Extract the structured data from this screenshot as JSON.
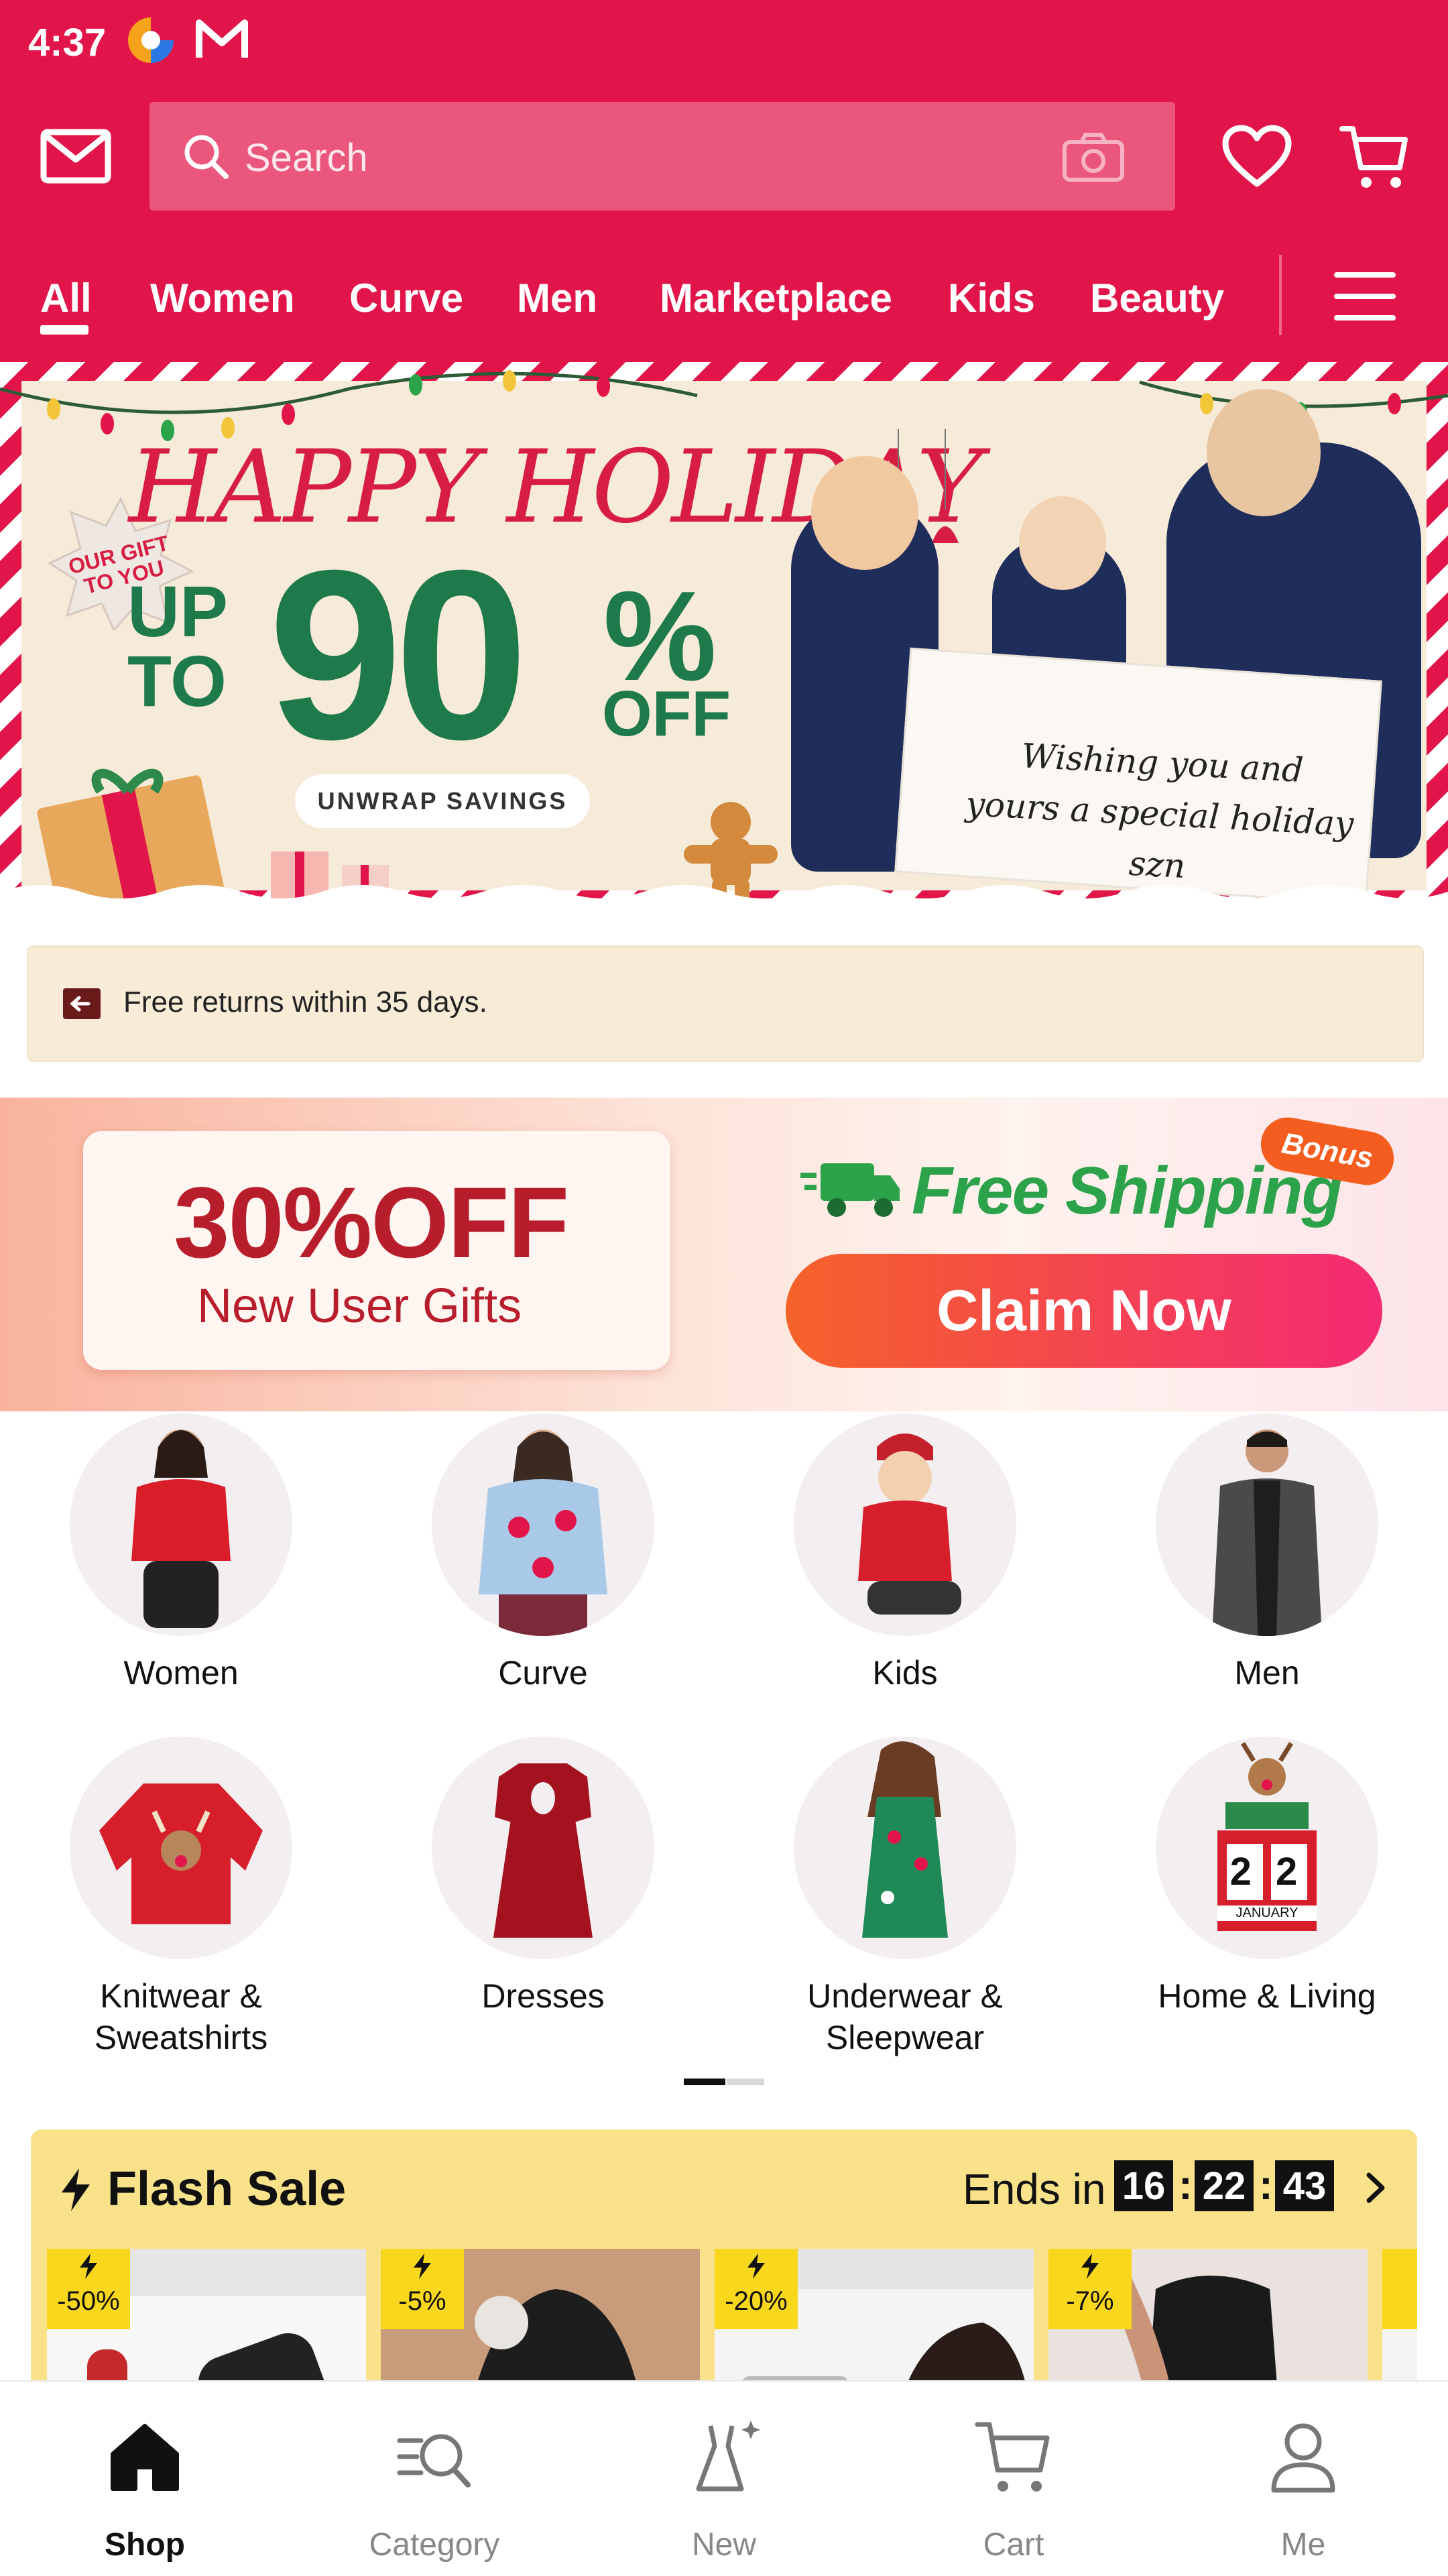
{
  "status_bar": {
    "time": "4:37"
  },
  "header": {
    "search_placeholder": "Search",
    "nav_tabs": [
      "All",
      "Women",
      "Curve",
      "Men",
      "Marketplace",
      "Kids",
      "Beauty"
    ],
    "active_tab": "All",
    "colors": {
      "brand": "#e2154a"
    }
  },
  "hero_banner": {
    "headline": "HAPPY HOLIDAY",
    "badge": "OUR GIFT TO YOU",
    "up_to_line1": "UP",
    "up_to_line2": "TO",
    "percent": "90",
    "percent_sign": "%",
    "off": "OFF",
    "cta": "UNWRAP SAVINGS",
    "card_text_line1": "Wishing you and",
    "card_text_line2": "yours a special holiday szn"
  },
  "info_bar": {
    "text": "Free returns within 35 days."
  },
  "promo": {
    "coupon_value": "30%OFF",
    "coupon_sub": "New User Gifts",
    "free_shipping": "Free Shipping",
    "bonus": "Bonus",
    "claim": "Claim Now"
  },
  "categories": [
    {
      "label": "Women",
      "icon": "woman-red-top-image"
    },
    {
      "label": "Curve",
      "icon": "curve-sweater-image"
    },
    {
      "label": "Kids",
      "icon": "kid-sweater-image"
    },
    {
      "label": "Men",
      "icon": "man-blazer-image"
    },
    {
      "label": "Knitwear &\nSweatshirts",
      "icon": "reindeer-sweater-image"
    },
    {
      "label": "Dresses",
      "icon": "red-dress-image"
    },
    {
      "label": "Underwear &\nSleepwear",
      "icon": "green-slip-image"
    },
    {
      "label": "Home & Living",
      "icon": "reindeer-calendar-image"
    }
  ],
  "calendar_text": {
    "day": "2 2",
    "month": "JANUARY"
  },
  "flash_sale": {
    "title": "Flash Sale",
    "ends_label": "Ends in",
    "timer": {
      "h": "16",
      "m": "22",
      "s": "43"
    },
    "products": [
      {
        "discount": "-50%"
      },
      {
        "discount": "-5%"
      },
      {
        "discount": "-20%"
      },
      {
        "discount": "-7%"
      }
    ]
  },
  "bottom_nav": [
    {
      "label": "Shop",
      "icon": "home-icon",
      "active": true
    },
    {
      "label": "Category",
      "icon": "category-search-icon",
      "active": false
    },
    {
      "label": "New",
      "icon": "dress-sparkle-icon",
      "active": false
    },
    {
      "label": "Cart",
      "icon": "cart-icon",
      "active": false
    },
    {
      "label": "Me",
      "icon": "person-icon",
      "active": false
    }
  ]
}
